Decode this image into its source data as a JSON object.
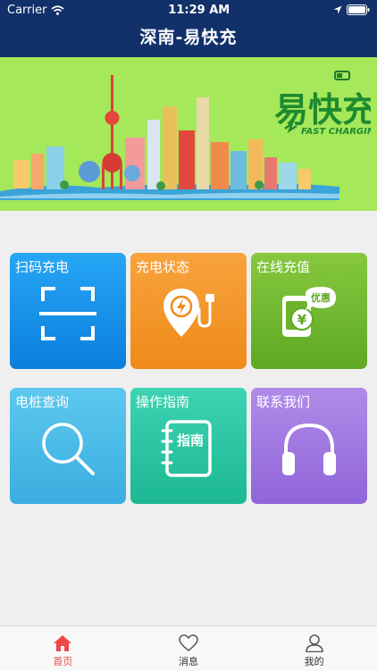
{
  "status_bar": {
    "carrier": "Carrier",
    "time": "11:29 AM"
  },
  "header": {
    "title": "深南-易快充"
  },
  "banner": {
    "logo_text": "易快充",
    "logo_subtitle": "FAST CHARGING"
  },
  "tiles": [
    {
      "label": "扫码充电",
      "icon": "scan-icon"
    },
    {
      "label": "充电状态",
      "icon": "charging-location-icon"
    },
    {
      "label": "在线充值",
      "icon": "recharge-card-icon",
      "badge": "优惠",
      "currency": "¥"
    },
    {
      "label": "电桩查询",
      "icon": "search-icon"
    },
    {
      "label": "操作指南",
      "icon": "guide-book-icon",
      "book_text": "指南"
    },
    {
      "label": "联系我们",
      "icon": "headphones-icon"
    }
  ],
  "tabbar": [
    {
      "label": "首页",
      "icon": "home-icon",
      "active": true
    },
    {
      "label": "消息",
      "icon": "heart-icon",
      "active": false
    },
    {
      "label": "我的",
      "icon": "user-icon",
      "active": false
    }
  ],
  "colors": {
    "header": "#12306a",
    "banner": "#a5e85a",
    "active_tab": "#f04848"
  }
}
